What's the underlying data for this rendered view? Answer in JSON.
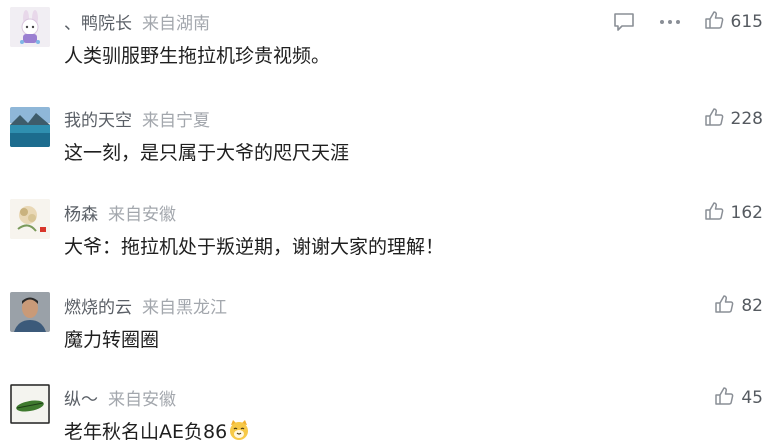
{
  "comments": [
    {
      "name": "、鸭院长",
      "location": "来自湖南",
      "text": "人类驯服野生拖拉机珍贵视频。",
      "likes": "615",
      "avatar_icon": "cartoon-rabbit-avatar",
      "show_reply": true,
      "show_more": true
    },
    {
      "name": "我的天空",
      "location": "来自宁夏",
      "text": "这一刻，是只属于大爷的咫尺天涯",
      "likes": "228",
      "avatar_icon": "mountain-lake-avatar"
    },
    {
      "name": "杨森",
      "location": "来自安徽",
      "text": "大爷：拖拉机处于叛逆期，谢谢大家的理解！",
      "likes": "162",
      "avatar_icon": "flower-avatar"
    },
    {
      "name": "燃烧的云",
      "location": "来自黑龙江",
      "text": "魔力转圈圈",
      "likes": "82",
      "avatar_icon": "man-portrait-avatar"
    },
    {
      "name": "纵～",
      "location": "来自安徽",
      "text": "老年秋名山AE负86",
      "likes": "45",
      "avatar_icon": "leaf-sketch-avatar",
      "text_emoji": "cat-face-emoji"
    }
  ],
  "colors": {
    "name": "#5a5f66",
    "location": "#a3a7ad",
    "text": "#1f1f1f",
    "icon": "#8a8f96"
  }
}
